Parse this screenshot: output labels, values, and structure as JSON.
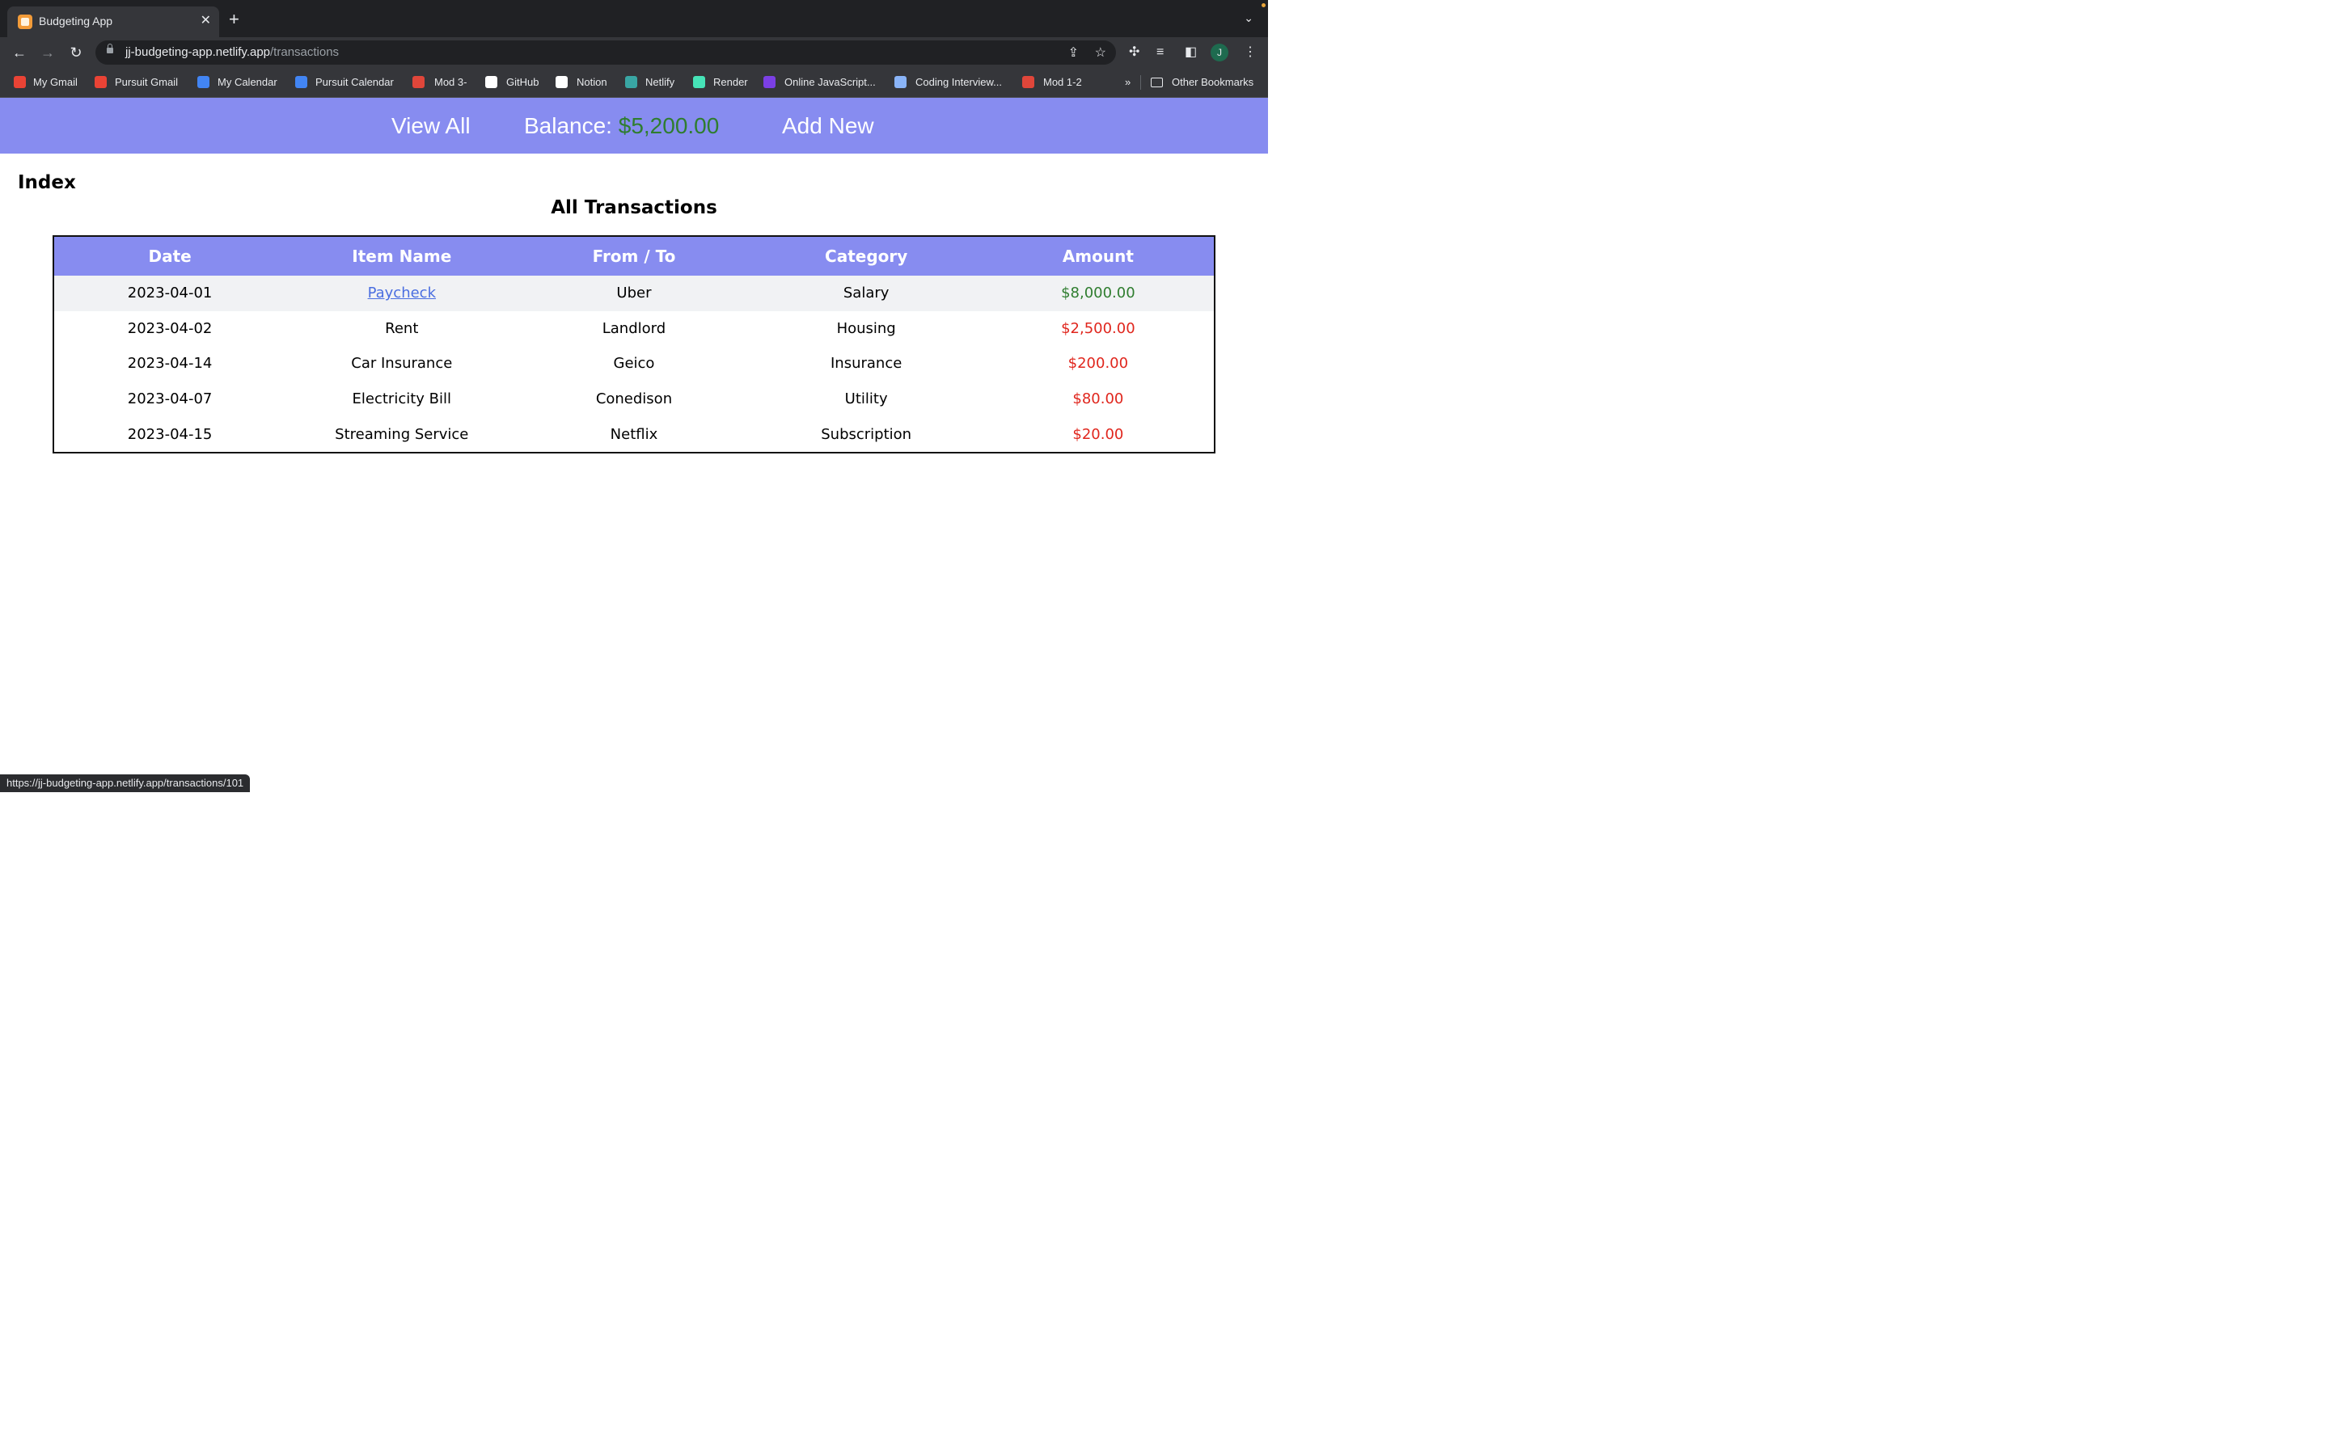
{
  "browser": {
    "tab_title": "Budgeting App",
    "tab_close": "✕",
    "new_tab": "+",
    "url_host": "jj-budgeting-app.netlify.app",
    "url_path": "/transactions",
    "profile_initial": "J",
    "bookmarks": [
      {
        "label": "My Gmail",
        "color": "#ea4335"
      },
      {
        "label": "Pursuit Gmail",
        "color": "#ea4335"
      },
      {
        "label": "My Calendar",
        "color": "#4285f4"
      },
      {
        "label": "Pursuit Calendar",
        "color": "#4285f4"
      },
      {
        "label": "Mod 3-",
        "color": "#e0463a"
      },
      {
        "label": "GitHub",
        "color": "#ffffff"
      },
      {
        "label": "Notion",
        "color": "#ffffff"
      },
      {
        "label": "Netlify",
        "color": "#39a6a4"
      },
      {
        "label": "Render",
        "color": "#46e3b7"
      },
      {
        "label": "Online JavaScript...",
        "color": "#7b3fe4"
      },
      {
        "label": "Coding Interview...",
        "color": "#8ab4f8"
      },
      {
        "label": "Mod 1-2",
        "color": "#e0463a"
      }
    ],
    "bookmarks_overflow": "»",
    "other_bookmarks": "Other Bookmarks",
    "status_url": "https://jj-budgeting-app.netlify.app/transactions/101"
  },
  "nav": {
    "view_all": "View All",
    "balance_label": "Balance: ",
    "balance_value": "$5,200.00",
    "add_new": "Add New"
  },
  "page": {
    "index_heading": "Index",
    "table_title": "All Transactions"
  },
  "table": {
    "headers": [
      "Date",
      "Item Name",
      "From / To",
      "Category",
      "Amount"
    ],
    "rows": [
      {
        "date": "2023-04-01",
        "item": "Paycheck",
        "from_to": "Uber",
        "category": "Salary",
        "amount": "$8,000.00"
      },
      {
        "date": "2023-04-02",
        "item": "Rent",
        "from_to": "Landlord",
        "category": "Housing",
        "amount": "$2,500.00"
      },
      {
        "date": "2023-04-14",
        "item": "Car Insurance",
        "from_to": "Geico",
        "category": "Insurance",
        "amount": "$200.00"
      },
      {
        "date": "2023-04-07",
        "item": "Electricity Bill",
        "from_to": "Conedison",
        "category": "Utility",
        "amount": "$80.00"
      },
      {
        "date": "2023-04-15",
        "item": "Streaming Service",
        "from_to": "Netflix",
        "category": "Subscription",
        "amount": "$20.00"
      }
    ]
  },
  "colors": {
    "nav_bg": "#878cf0",
    "positive": "#2f7d2f",
    "negative": "#e0261d",
    "link": "#4a6ee0"
  }
}
